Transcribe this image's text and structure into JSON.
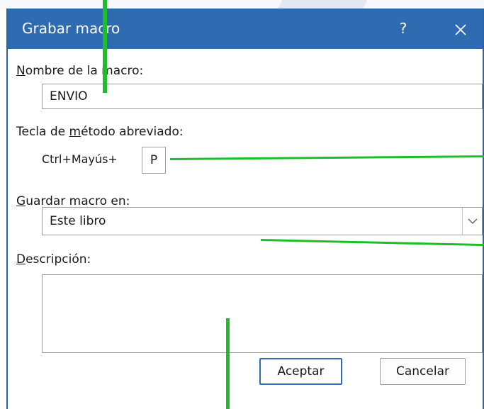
{
  "dialog": {
    "title": "Grabar macro",
    "help_label": "?",
    "close_icon": "close-icon"
  },
  "macro_name": {
    "label_first": "N",
    "label_rest": "ombre de la macro:",
    "value": "ENVIO"
  },
  "shortcut": {
    "label_before": "Tecla de ",
    "label_underlined": "m",
    "label_after": "étodo abreviado:",
    "prefix": "Ctrl+Mayús+",
    "value": "P"
  },
  "store_in": {
    "label_first": "G",
    "label_rest": "uardar macro en:",
    "selected": "Este libro",
    "arrow_icon": "chevron-down-icon"
  },
  "description": {
    "label_first": "D",
    "label_rest": "escripción:",
    "value": ""
  },
  "buttons": {
    "ok_label": "Aceptar",
    "cancel_label": "Cancelar"
  },
  "colors": {
    "titlebar": "#2e6bb0",
    "annotation_line": "#1dbe2a"
  }
}
